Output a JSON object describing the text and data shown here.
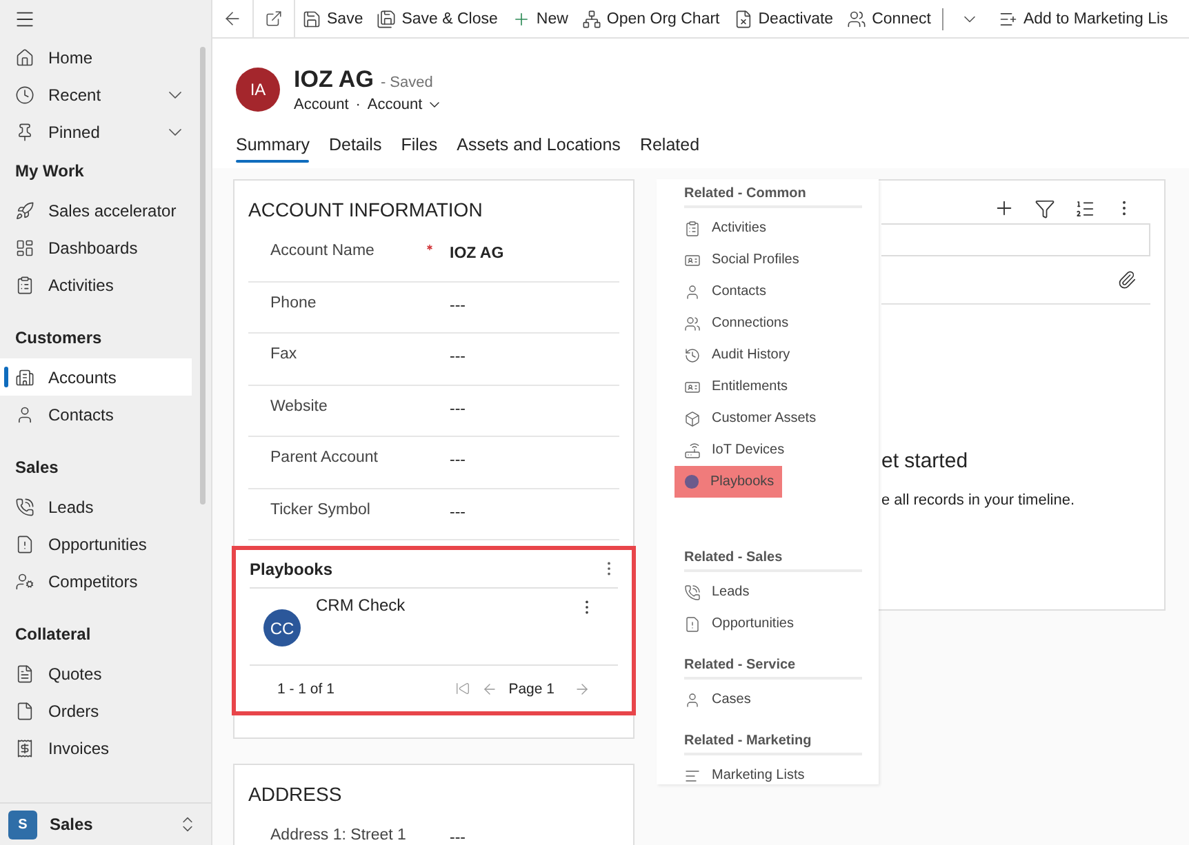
{
  "sidebar": {
    "groups": [
      {
        "items": [
          {
            "label": "Home",
            "kind": "link",
            "selected": false
          },
          {
            "label": "Recent",
            "kind": "expander",
            "selected": false
          },
          {
            "label": "Pinned",
            "kind": "expander",
            "selected": false
          }
        ]
      },
      {
        "title": "My Work",
        "items": [
          {
            "label": "Sales accelerator",
            "kind": "link",
            "selected": false
          },
          {
            "label": "Dashboards",
            "kind": "link",
            "selected": false
          },
          {
            "label": "Activities",
            "kind": "link",
            "selected": false
          }
        ]
      },
      {
        "title": "Customers",
        "items": [
          {
            "label": "Accounts",
            "kind": "link",
            "selected": true
          },
          {
            "label": "Contacts",
            "kind": "link",
            "selected": false
          }
        ]
      },
      {
        "title": "Sales",
        "items": [
          {
            "label": "Leads",
            "kind": "link",
            "selected": false
          },
          {
            "label": "Opportunities",
            "kind": "link",
            "selected": false
          },
          {
            "label": "Competitors",
            "kind": "link",
            "selected": false
          }
        ]
      },
      {
        "title": "Collateral",
        "items": [
          {
            "label": "Quotes",
            "kind": "link",
            "selected": false
          },
          {
            "label": "Orders",
            "kind": "link",
            "selected": false
          },
          {
            "label": "Invoices",
            "kind": "link",
            "selected": false
          }
        ]
      }
    ],
    "area_switcher": {
      "badge": "S",
      "label": "Sales"
    }
  },
  "toolbar": {
    "items": [
      {
        "label": "Save"
      },
      {
        "label": "Save & Close"
      },
      {
        "label": "New"
      },
      {
        "label": "Open Org Chart"
      },
      {
        "label": "Deactivate"
      },
      {
        "label": "Connect"
      },
      {
        "label": "Add to Marketing Lis"
      }
    ]
  },
  "header": {
    "avatar": "IA",
    "title": "IOZ AG",
    "status": "- Saved",
    "entity": "Account",
    "separator": "·",
    "form": "Account"
  },
  "tabs": [
    {
      "label": "Summary",
      "selected": true
    },
    {
      "label": "Details",
      "selected": false
    },
    {
      "label": "Files",
      "selected": false
    },
    {
      "label": "Assets and Locations",
      "selected": false
    },
    {
      "label": "Related",
      "selected": false
    }
  ],
  "account_information": {
    "title": "ACCOUNT INFORMATION",
    "fields": [
      {
        "label": "Account Name",
        "value": "IOZ AG",
        "required": true
      },
      {
        "label": "Phone",
        "value": "---",
        "required": false
      },
      {
        "label": "Fax",
        "value": "---",
        "required": false
      },
      {
        "label": "Website",
        "value": "---",
        "required": false
      },
      {
        "label": "Parent Account",
        "value": "---",
        "required": false
      },
      {
        "label": "Ticker Symbol",
        "value": "---",
        "required": false
      }
    ]
  },
  "playbooks": {
    "title": "Playbooks",
    "rows": [
      {
        "avatar": "CC",
        "name": "CRM Check"
      }
    ],
    "range": "1 - 1 of 1",
    "page": "Page 1"
  },
  "address": {
    "title": "ADDRESS",
    "fields": [
      {
        "label": "Address 1: Street 1",
        "value": "---"
      }
    ]
  },
  "timeline": {
    "heading": "et started",
    "text": "e all records in your timeline."
  },
  "related_menu": {
    "groups": [
      {
        "title": "Related - Common",
        "items": [
          {
            "label": "Activities",
            "selected": false
          },
          {
            "label": "Social Profiles",
            "selected": false
          },
          {
            "label": "Contacts",
            "selected": false
          },
          {
            "label": "Connections",
            "selected": false
          },
          {
            "label": "Audit History",
            "selected": false
          },
          {
            "label": "Entitlements",
            "selected": false
          },
          {
            "label": "Customer Assets",
            "selected": false
          },
          {
            "label": "IoT Devices",
            "selected": false
          },
          {
            "label": "Playbooks",
            "selected": true
          }
        ]
      },
      {
        "title": "Related - Sales",
        "items": [
          {
            "label": "Leads",
            "selected": false
          },
          {
            "label": "Opportunities",
            "selected": false
          }
        ]
      },
      {
        "title": "Related - Service",
        "items": [
          {
            "label": "Cases",
            "selected": false
          }
        ]
      },
      {
        "title": "Related - Marketing",
        "items": [
          {
            "label": "Marketing Lists",
            "selected": false
          }
        ]
      }
    ]
  }
}
